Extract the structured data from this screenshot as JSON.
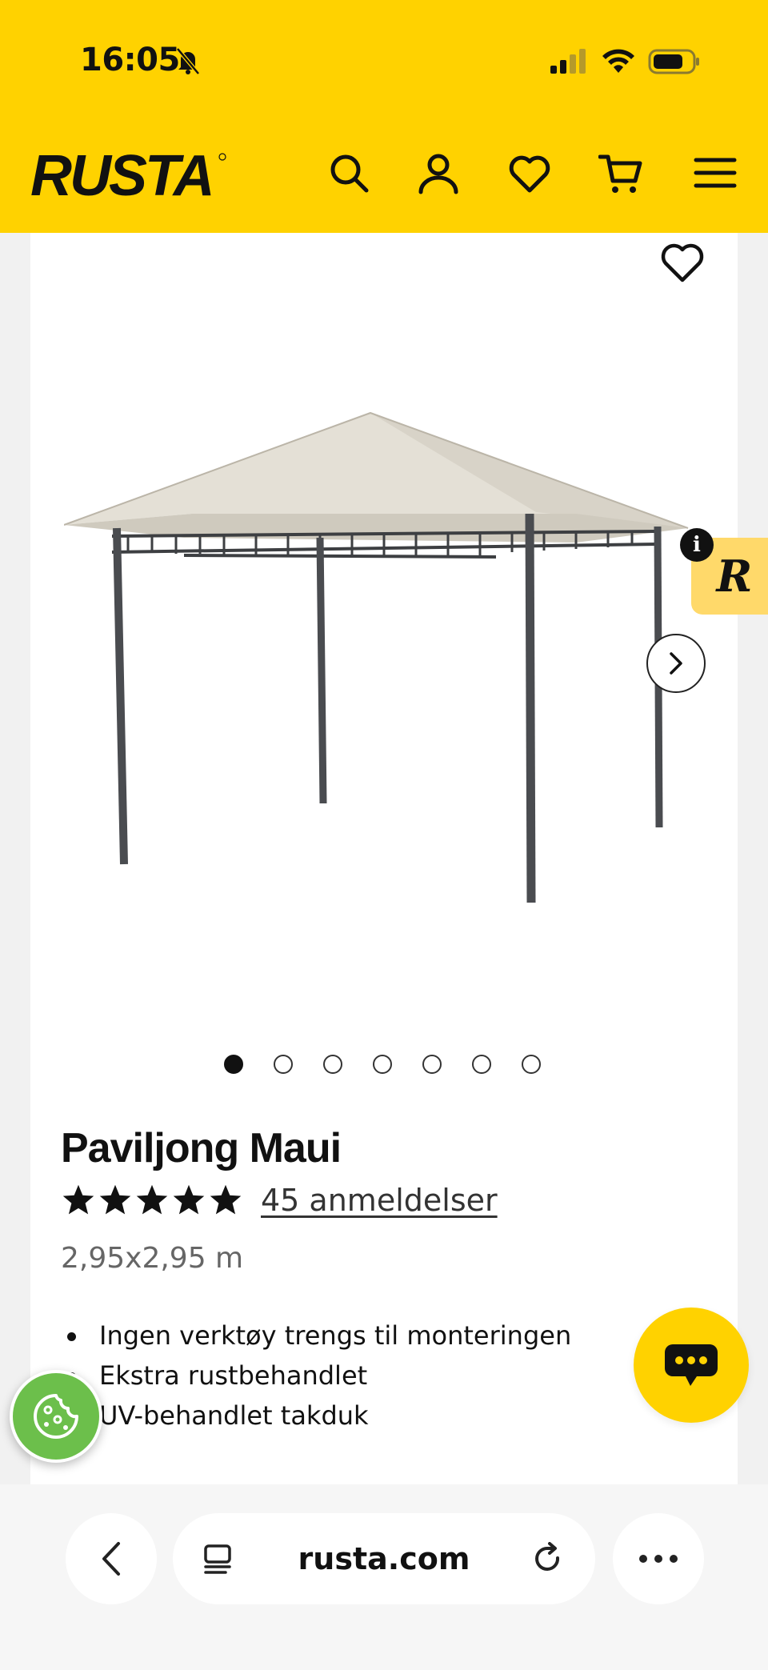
{
  "status_bar": {
    "time": "16:05"
  },
  "header": {
    "brand": "RUSTA",
    "icons": [
      "search-icon",
      "account-icon",
      "heart-icon",
      "cart-icon",
      "menu-icon"
    ]
  },
  "product": {
    "title": "Paviljong Maui",
    "rating": 5,
    "reviews_label": "45 anmeldelser",
    "size": "2,95x2,95 m",
    "features": [
      "Ingen verktøy trengs til monteringen",
      "Ekstra rustbehandlet",
      "UV-behandlet takduk"
    ],
    "image_count": 7,
    "active_image": 1
  },
  "badge": {
    "letter": "R",
    "info": "i"
  },
  "browser": {
    "url": "rusta.com"
  },
  "colors": {
    "brand_yellow": "#ffd200",
    "cookie_green": "#6cbf4b",
    "badge_yellow": "#ffd96a"
  }
}
